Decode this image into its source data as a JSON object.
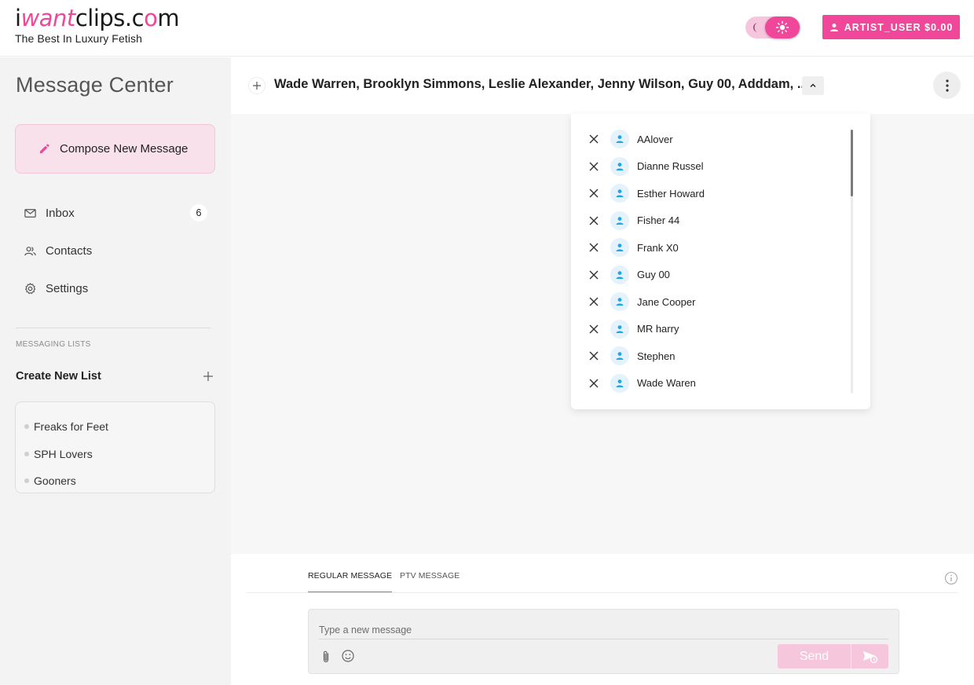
{
  "brand": {
    "logo_part1": "i",
    "logo_part2": "want",
    "logo_part3": "clips.c",
    "logo_part4": "o",
    "logo_part5": "m",
    "tagline": "The Best In Luxury Fetish"
  },
  "header": {
    "theme_mode": "light",
    "user_button_label": "ARTIST_USER $0.00",
    "accent_color": "#f0479a"
  },
  "sidebar": {
    "title": "Message Center",
    "compose_label": "Compose New Message",
    "nav": [
      {
        "label": "Inbox",
        "icon": "mail-icon",
        "badge": "6"
      },
      {
        "label": "Contacts",
        "icon": "contacts-icon"
      },
      {
        "label": "Settings",
        "icon": "gear-icon"
      }
    ],
    "section_label": "MESSAGING LISTS",
    "create_list_label": "Create New List",
    "lists": [
      "Freaks for Feet",
      "SPH Lovers",
      "Gooners"
    ]
  },
  "conversation": {
    "recipients_title": "Wade Warren, Brooklyn Simmons, Leslie Alexander, Jenny Wilson, Guy 00, Adddam, ...",
    "recipients": [
      "AAlover",
      "Dianne Russel",
      "Esther Howard",
      "Fisher 44",
      "Frank X0",
      "Guy 00",
      "Jane Cooper",
      "MR harry",
      "Stephen",
      "Wade Waren"
    ]
  },
  "composer": {
    "tab_regular": "REGULAR MESSAGE",
    "tab_ptv": "PTV MESSAGE",
    "input_placeholder": "Type a new message",
    "send_label": "Send"
  }
}
